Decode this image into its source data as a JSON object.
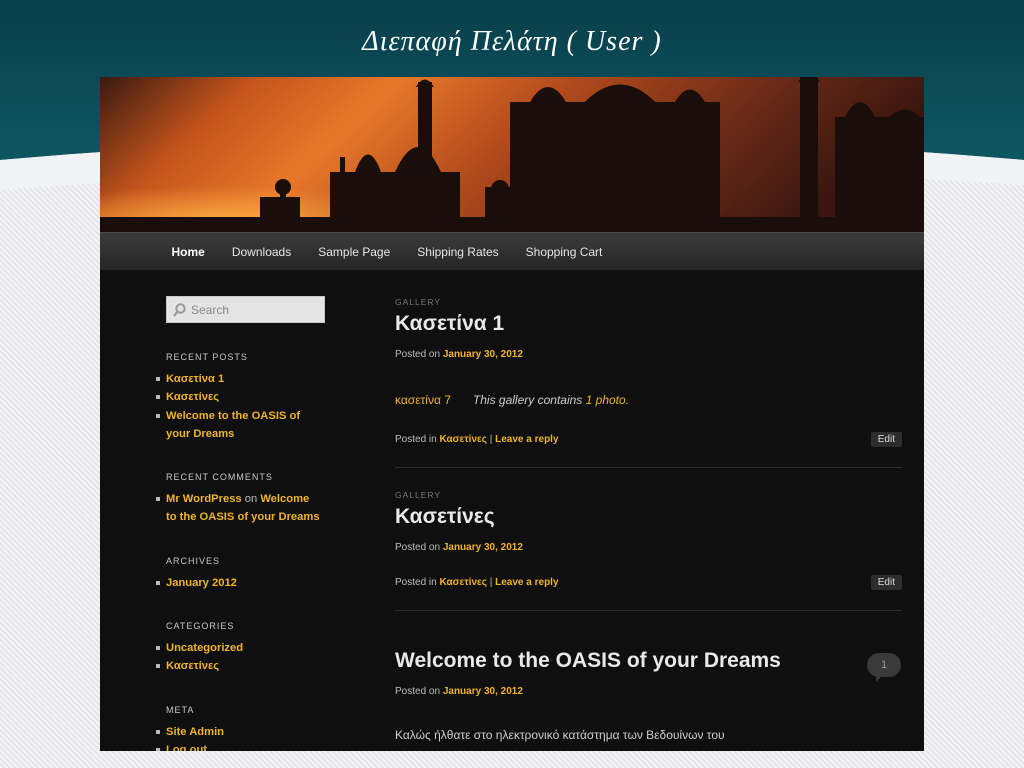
{
  "slide": {
    "title": "Διεπαφή   Πελάτη  ( User )"
  },
  "nav": [
    "Home",
    "Downloads",
    "Sample Page",
    "Shipping Rates",
    "Shopping Cart"
  ],
  "search": {
    "placeholder": "Search"
  },
  "sidebar": {
    "recent_posts": {
      "title": "RECENT POSTS",
      "items": [
        "Κασετίνα 1",
        "Κασετίνες",
        "Welcome to the OASIS of",
        "your Dreams"
      ]
    },
    "recent_comments": {
      "title": "RECENT COMMENTS",
      "author": "Mr WordPress",
      "on": "on",
      "post_a": "Welcome",
      "post_b": "to the OASIS of your Dreams"
    },
    "archives": {
      "title": "ARCHIVES",
      "items": [
        "January 2012"
      ]
    },
    "categories": {
      "title": "CATEGORIES",
      "items": [
        "Uncategorized",
        "Κασετίνες"
      ]
    },
    "meta": {
      "title": "META",
      "items": [
        "Site Admin",
        "Log out"
      ]
    }
  },
  "posts": [
    {
      "category": "GALLERY",
      "title": "Κασετίνα 1",
      "posted_on": "Posted on",
      "date": "January 30, 2012",
      "thumb": "κασετίνα 7",
      "gallery_text": "This gallery contains",
      "gallery_count": "1 photo",
      "gallery_end": ".",
      "posted_in": "Posted in",
      "cat_link": "Κασετίνες",
      "sep": "|",
      "reply": "Leave a reply",
      "edit": "Edit"
    },
    {
      "category": "GALLERY",
      "title": "Κασετίνες",
      "posted_on": "Posted on",
      "date": "January 30, 2012",
      "posted_in": "Posted in",
      "cat_link": "Κασετίνες",
      "sep": "|",
      "reply": "Leave a reply",
      "edit": "Edit"
    },
    {
      "title": "Welcome to the OASIS of your Dreams",
      "comments": "1",
      "posted_on": "Posted on",
      "date": "January 30, 2012",
      "excerpt": "Καλώς ήλθατε στο ηλεκτρονικό κατάστημα των Βεδουίνων του"
    }
  ],
  "colors": {
    "accent": "#f0b429",
    "background": "#0f0f0f",
    "slide_top": "#0b4a55"
  }
}
